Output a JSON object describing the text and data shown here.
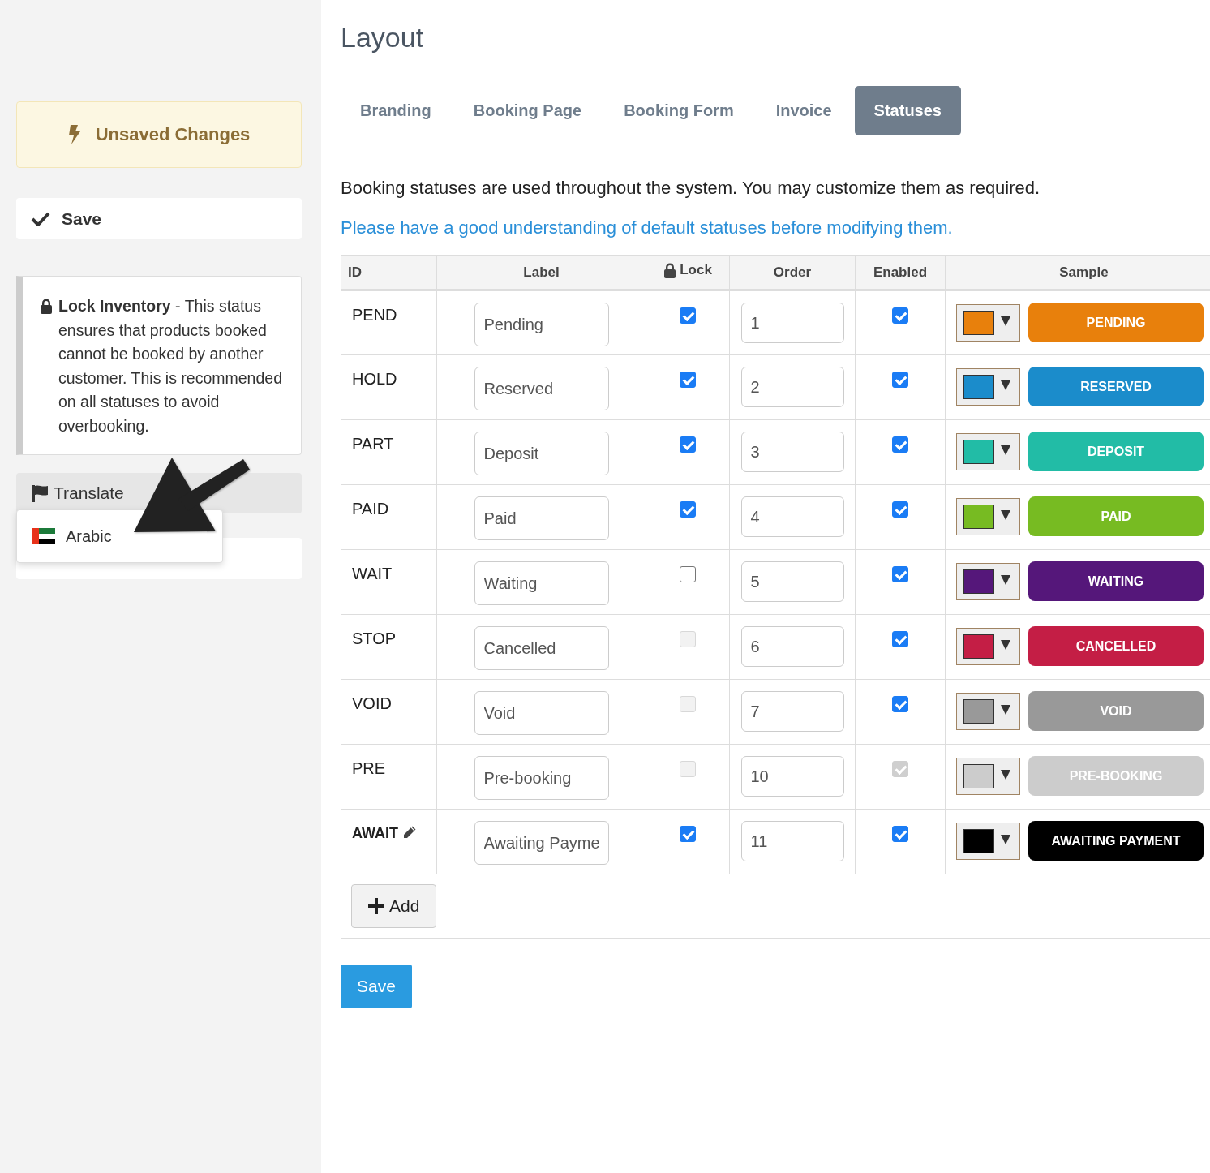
{
  "sidebar": {
    "unsaved_notice": "Unsaved Changes",
    "save_button": "Save",
    "lock_note": "**Lock Inventory** - This status ensures that products booked cannot be booked by another customer. This is recommended on all statuses to avoid overbooking.",
    "translate_button": "Translate",
    "language_menu": {
      "items": [
        "Arabic"
      ]
    }
  },
  "page": {
    "title": "Layout",
    "tabs": [
      {
        "label": "Branding",
        "selected": false
      },
      {
        "label": "Booking Page",
        "selected": false
      },
      {
        "label": "Booking Form",
        "selected": false
      },
      {
        "label": "Invoice",
        "selected": false
      },
      {
        "label": "Statuses",
        "selected": true
      }
    ],
    "description": "Booking statuses are used throughout the system. You may customize them as required.",
    "link": "Please have a good understanding of default statuses before modifying them.",
    "table": {
      "columns": [
        "ID",
        "Label",
        "Lock",
        "Order",
        "Enabled",
        "Sample"
      ],
      "rows": [
        {
          "id": "PEND",
          "editable": false,
          "label": "Pending",
          "lock": {
            "checked": true,
            "disabled": false
          },
          "order": "1",
          "enabled": {
            "checked": true,
            "disabled": false
          },
          "color": "#e8800c",
          "sample": "PENDING"
        },
        {
          "id": "HOLD",
          "editable": false,
          "label": "Reserved",
          "lock": {
            "checked": true,
            "disabled": false
          },
          "order": "2",
          "enabled": {
            "checked": true,
            "disabled": false
          },
          "color": "#1b8ccb",
          "sample": "RESERVED"
        },
        {
          "id": "PART",
          "editable": false,
          "label": "Deposit",
          "lock": {
            "checked": true,
            "disabled": false
          },
          "order": "3",
          "enabled": {
            "checked": true,
            "disabled": false
          },
          "color": "#22bca6",
          "sample": "DEPOSIT"
        },
        {
          "id": "PAID",
          "editable": false,
          "label": "Paid",
          "lock": {
            "checked": true,
            "disabled": false
          },
          "order": "4",
          "enabled": {
            "checked": true,
            "disabled": false
          },
          "color": "#77bb22",
          "sample": "PAID"
        },
        {
          "id": "WAIT",
          "editable": false,
          "label": "Waiting",
          "lock": {
            "checked": false,
            "disabled": false
          },
          "order": "5",
          "enabled": {
            "checked": true,
            "disabled": false
          },
          "color": "#55177a",
          "sample": "WAITING"
        },
        {
          "id": "STOP",
          "editable": false,
          "label": "Cancelled",
          "lock": {
            "checked": false,
            "disabled": true
          },
          "order": "6",
          "enabled": {
            "checked": true,
            "disabled": false
          },
          "color": "#c41e45",
          "sample": "CANCELLED"
        },
        {
          "id": "VOID",
          "editable": false,
          "label": "Void",
          "lock": {
            "checked": false,
            "disabled": true
          },
          "order": "7",
          "enabled": {
            "checked": true,
            "disabled": false
          },
          "color": "#999999",
          "sample": "VOID"
        },
        {
          "id": "PRE",
          "editable": false,
          "label": "Pre-booking",
          "lock": {
            "checked": false,
            "disabled": true
          },
          "order": "10",
          "enabled": {
            "checked": true,
            "disabled": true
          },
          "color": "#cccccc",
          "sample": "PRE-BOOKING"
        },
        {
          "id": "AWAIT",
          "editable": true,
          "label": "Awaiting Payme",
          "lock": {
            "checked": true,
            "disabled": false
          },
          "order": "11",
          "enabled": {
            "checked": true,
            "disabled": false
          },
          "color": "#000000",
          "sample": "AWAITING PAYMENT"
        }
      ],
      "add_button": "Add"
    },
    "save_button": "Save"
  }
}
